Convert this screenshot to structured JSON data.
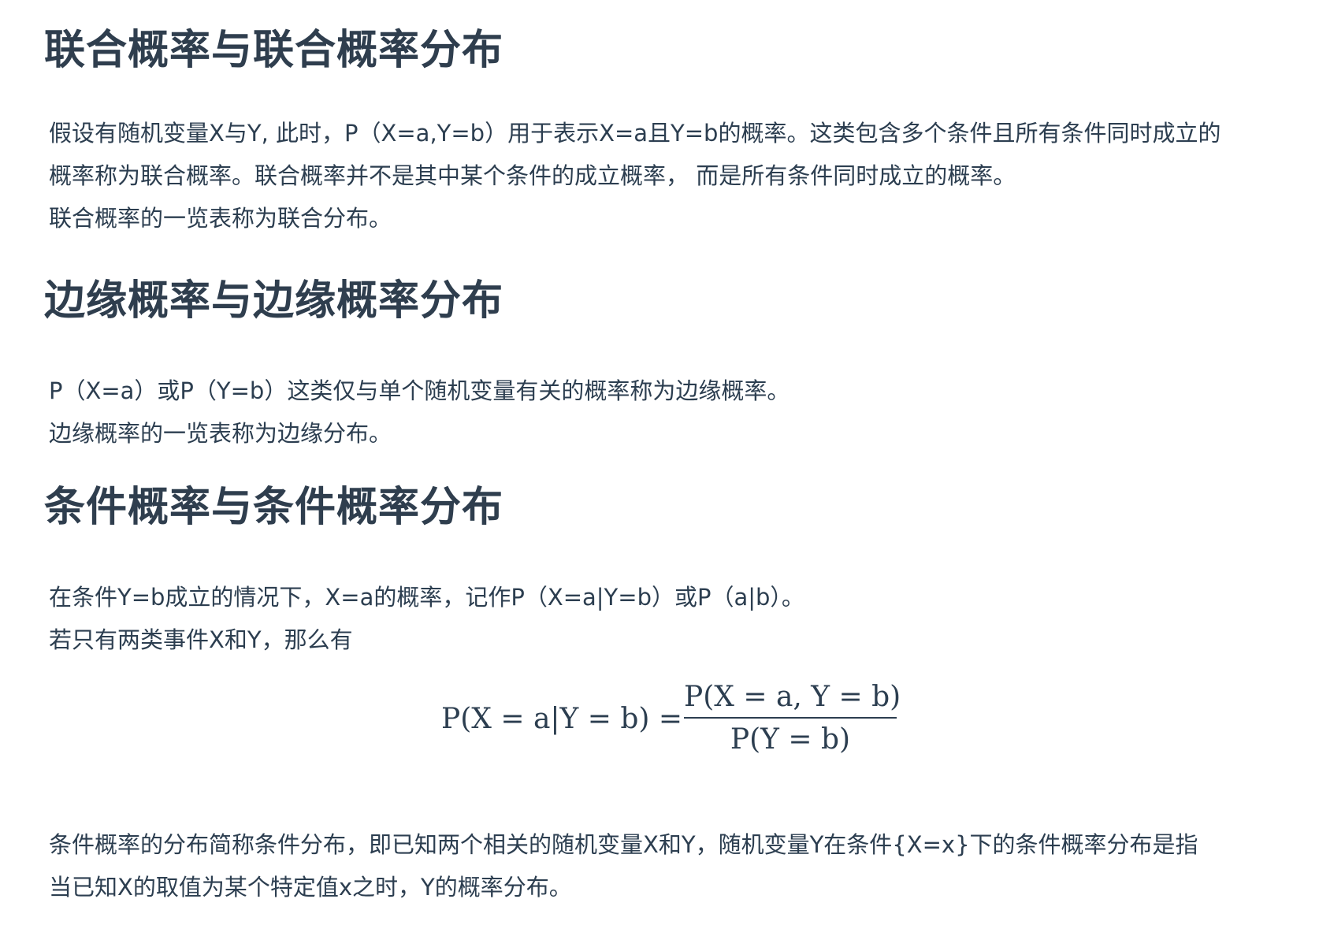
{
  "sections": [
    {
      "heading": "联合概率与联合概率分布",
      "lines": [
        "假设有随机变量X与Y, 此时，P（X=a,Y=b）用于表示X=a且Y=b的概率。这类包含多个条件且所有条件同时成立的",
        "概率称为联合概率。联合概率并不是其中某个条件的成立概率， 而是所有条件同时成立的概率。",
        "联合概率的一览表称为联合分布。"
      ]
    },
    {
      "heading": "边缘概率与边缘概率分布",
      "lines": [
        "P（X=a）或P（Y=b）这类仅与单个随机变量有关的概率称为边缘概率。",
        "边缘概率的一览表称为边缘分布。"
      ]
    },
    {
      "heading": "条件概率与条件概率分布",
      "lines": [
        "在条件Y=b成立的情况下，X=a的概率，记作P（X=a|Y=b）或P（a|b）。",
        "若只有两类事件X和Y，那么有"
      ],
      "formula": {
        "lhs": "P(X = a|Y = b) =",
        "numerator": "P(X = a, Y = b)",
        "denominator": "P(Y = b)"
      },
      "after_lines": [
        "条件概率的分布简称条件分布，即已知两个相关的随机变量X和Y，随机变量Y在条件{X=x}下的条件概率分布是指",
        "当已知X的取值为某个特定值x之时，Y的概率分布。"
      ]
    }
  ]
}
